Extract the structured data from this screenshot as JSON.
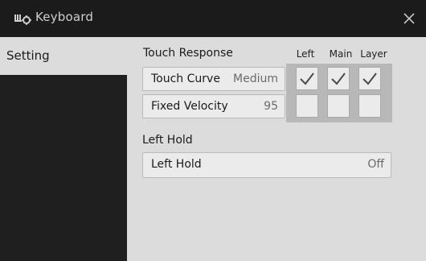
{
  "window": {
    "title": "Keyboard",
    "icon": "keyboard-settings-icon",
    "close_icon": "close-icon"
  },
  "sidebar": {
    "tabs": [
      {
        "label": "Setting",
        "selected": true
      }
    ]
  },
  "touch_response": {
    "heading": "Touch Response",
    "columns": [
      "Left",
      "Main",
      "Layer"
    ],
    "rows": [
      {
        "label": "Touch Curve",
        "value": "Medium",
        "checks": [
          true,
          true,
          true
        ]
      },
      {
        "label": "Fixed Velocity",
        "value": "95",
        "checks": [
          false,
          false,
          false
        ]
      }
    ]
  },
  "left_hold": {
    "heading": "Left Hold",
    "button": {
      "label": "Left Hold",
      "value": "Off"
    }
  }
}
